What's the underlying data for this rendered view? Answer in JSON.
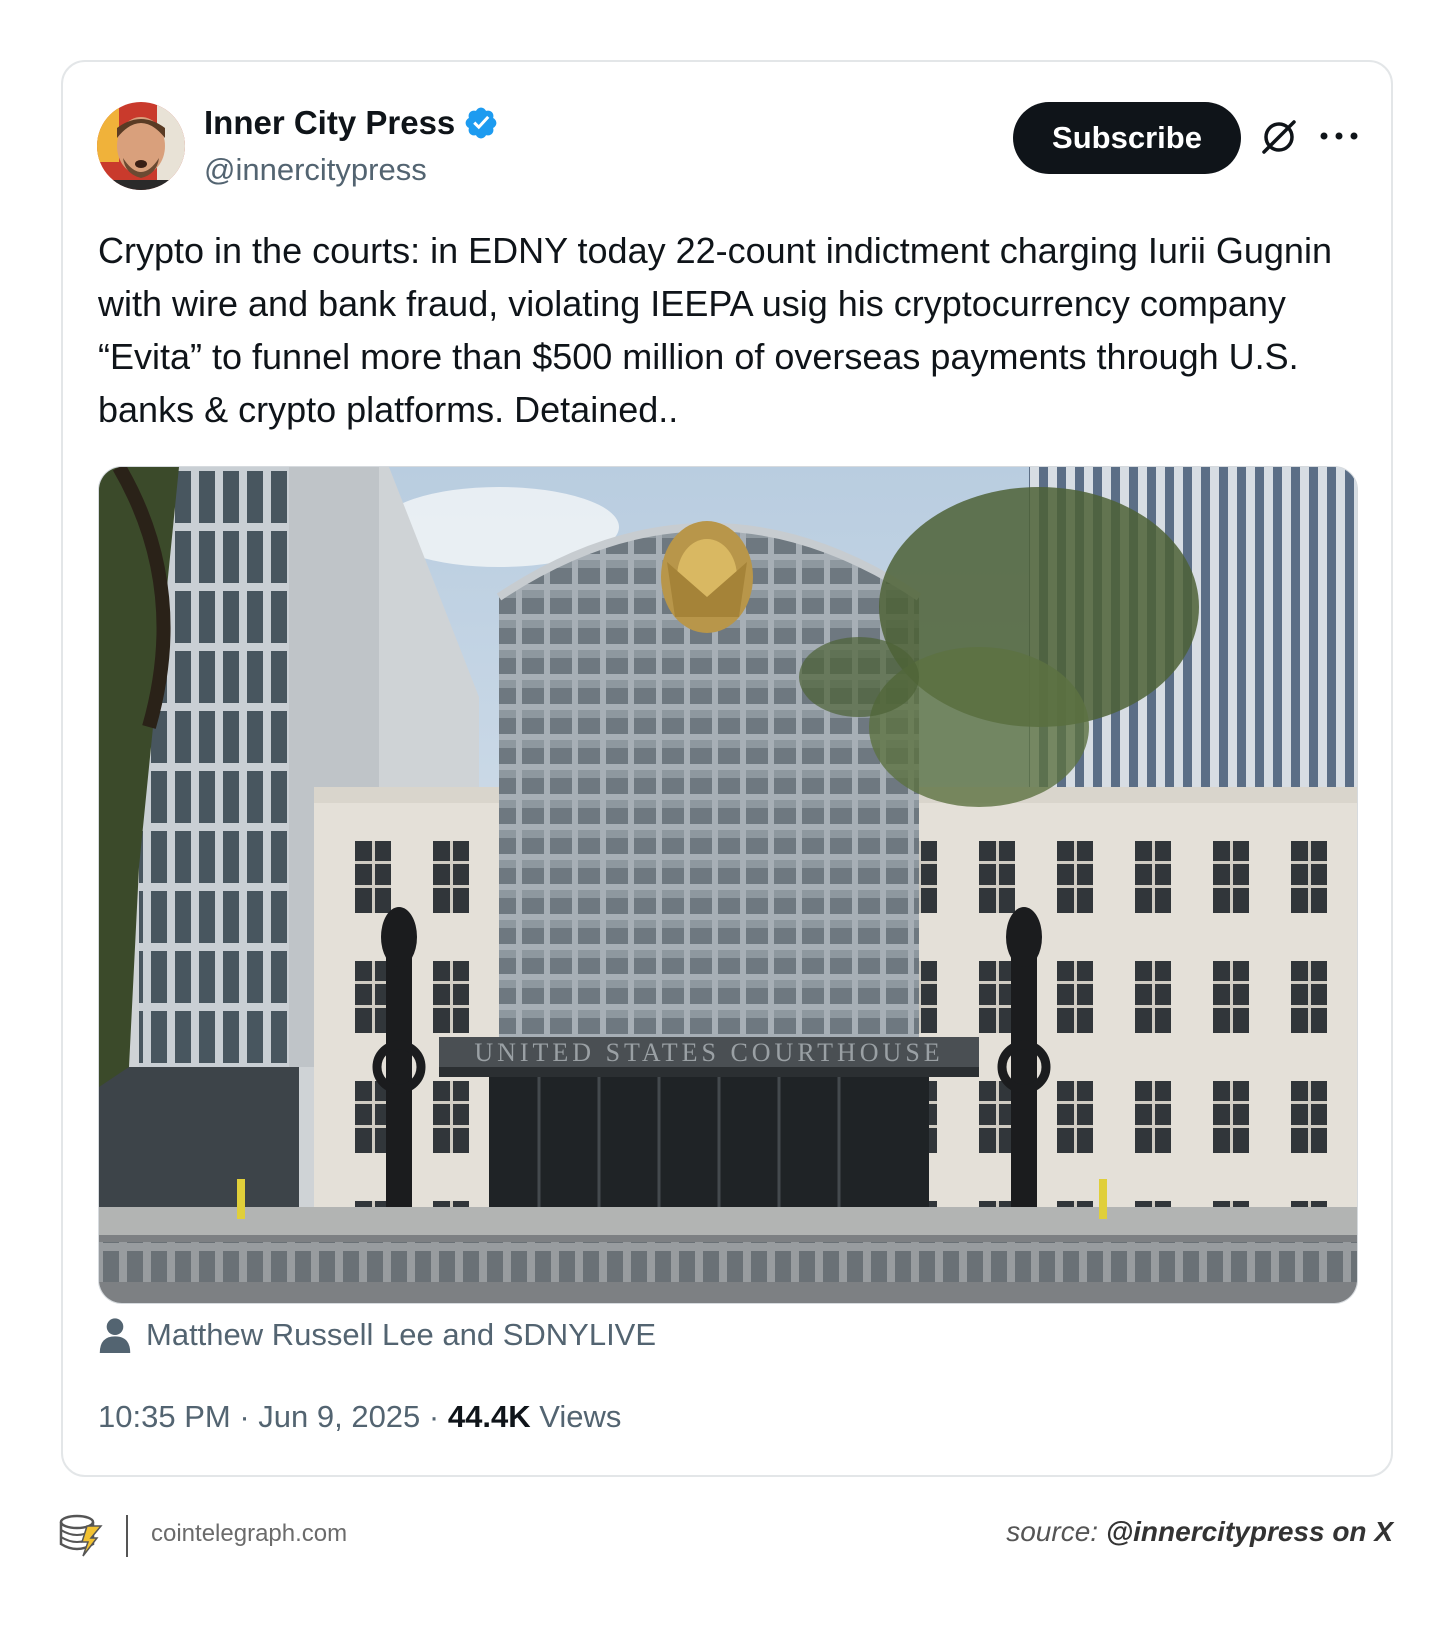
{
  "tweet": {
    "author_name": "Inner City Press",
    "author_handle": "@innercitypress",
    "subscribe_label": "Subscribe",
    "text": "Crypto in the courts: in EDNY today 22-count indictment charging Iurii Gugnin with wire and bank fraud, violating IEEPA usig his cryptocurrency company “Evita” to funnel more than $500 million of overseas payments through U.S. banks & crypto platforms. Detained..",
    "image_alt_sign": "UNITED STATES COURTHOUSE",
    "media_credit": "Matthew Russell Lee and SDNYLIVE",
    "time": "10:35 PM",
    "date": "Jun 9, 2025",
    "separator": " · ",
    "views_count": "44.4K",
    "views_label": "Views"
  },
  "footer": {
    "site": "cointelegraph.com",
    "source_prefix": "source: ",
    "source_handle": "@innercitypress on X"
  },
  "colors": {
    "text_primary": "#0f1419",
    "text_secondary": "#536471",
    "verified_blue": "#1d9bf0",
    "button_bg": "#0f1419"
  },
  "icons": {
    "verified": "verified-badge-icon",
    "grok": "grok-icon",
    "more": "more-icon",
    "person": "person-icon",
    "logo": "cointelegraph-logo-icon"
  }
}
